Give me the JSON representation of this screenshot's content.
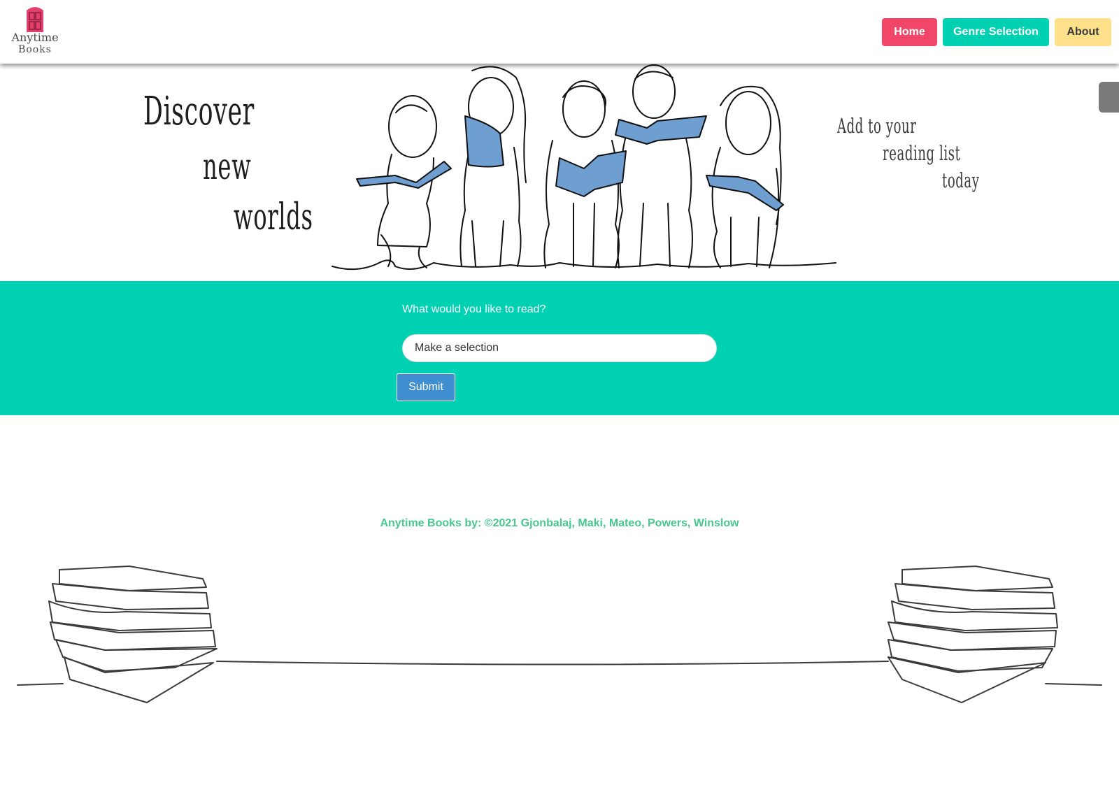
{
  "navbar": {
    "logo": {
      "line1": "Anytime",
      "line2": "Books"
    },
    "items": [
      {
        "label": "Home",
        "color": "#f14668"
      },
      {
        "label": "Genre Selection",
        "color": "#00d1b2"
      },
      {
        "label": "About",
        "color": "#ffe08a"
      }
    ]
  },
  "hero": {
    "left_text": [
      "Discover",
      "new",
      "worlds"
    ],
    "right_text": [
      "Add to your",
      "reading list",
      "today"
    ],
    "illustration": "line-drawing-children-reading-books",
    "book_fill_color": "#6f9ed0"
  },
  "form": {
    "label": "What would you like to read?",
    "select_value": "Make a selection",
    "submit_label": "Submit",
    "band_color": "#00d1b2"
  },
  "footer": {
    "credit": "Anytime Books by: ©2021 Gjonbalaj, Maki, Mateo, Powers, Winslow",
    "illustration": "line-drawing-book-stacks",
    "text_color": "#48c78e"
  }
}
